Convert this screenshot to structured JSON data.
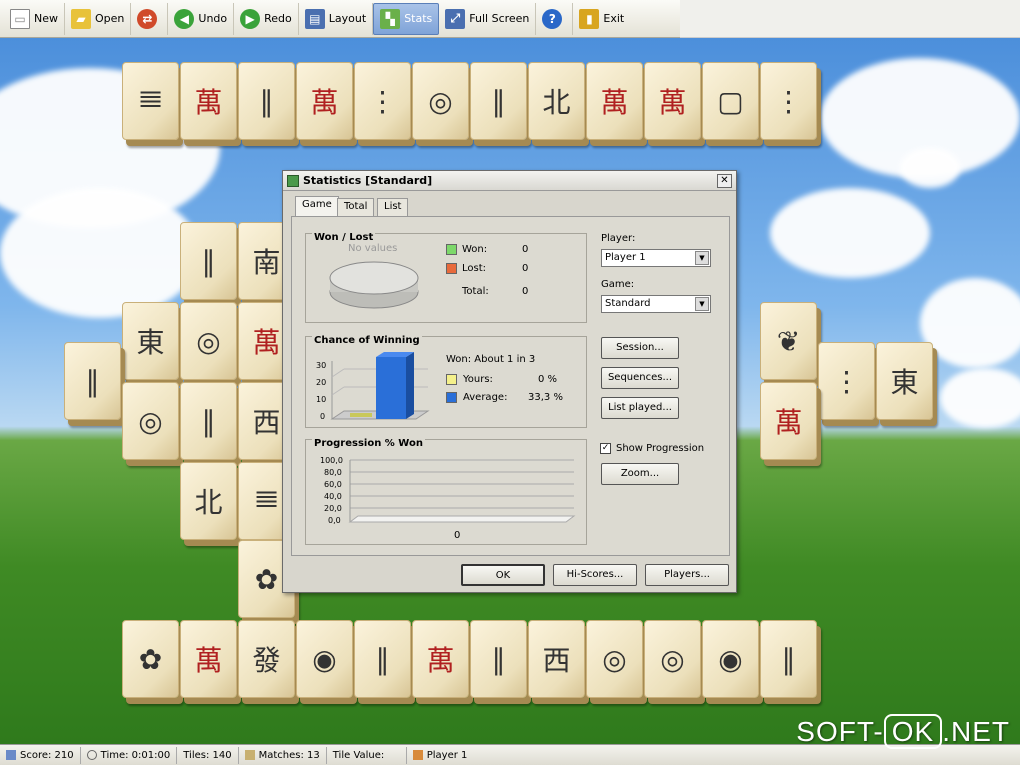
{
  "toolbar": {
    "new": "New",
    "open": "Open",
    "undo": "Undo",
    "redo": "Redo",
    "layout": "Layout",
    "stats": "Stats",
    "fullscreen": "Full Screen",
    "exit": "Exit"
  },
  "dialog": {
    "title": "Statistics [Standard]",
    "tabs": [
      "Game",
      "Total",
      "List"
    ],
    "won_lost": {
      "title": "Won / Lost",
      "no_values": "No values",
      "won_label": "Won:",
      "won_value": "0",
      "lost_label": "Lost:",
      "lost_value": "0",
      "total_label": "Total:",
      "total_value": "0"
    },
    "chance": {
      "title": "Chance of Winning",
      "won_text": "Won:  About 1 in 3",
      "yours_label": "Yours:",
      "yours_value": "0 %",
      "average_label": "Average:",
      "average_value": "33,3 %",
      "yaxis": [
        "30",
        "20",
        "10",
        "0"
      ]
    },
    "progression": {
      "title": "Progression % Won",
      "yaxis": [
        "100,0",
        "80,0",
        "60,0",
        "40,0",
        "20,0",
        "0,0"
      ],
      "xlabel": "0"
    },
    "player_label": "Player:",
    "player_value": "Player 1",
    "game_label": "Game:",
    "game_value": "Standard",
    "session_btn": "Session...",
    "sequences_btn": "Sequences...",
    "list_played_btn": "List played...",
    "show_progression": "Show Progression",
    "zoom_btn": "Zoom...",
    "ok_btn": "OK",
    "hiscores_btn": "Hi-Scores...",
    "players_btn": "Players..."
  },
  "status": {
    "score": "Score: 210",
    "time": "Time: 0:01:00",
    "tiles": "Tiles: 140",
    "matches": "Matches: 13",
    "tile_value": "Tile Value:",
    "player": "Player 1"
  },
  "watermark": {
    "left": "SOFT-",
    "box": "OK",
    "right": ".NET"
  },
  "colors": {
    "won": "#7dd86a",
    "lost": "#e86a3c",
    "yours": "#f4f08a",
    "average": "#2a6fd8"
  }
}
